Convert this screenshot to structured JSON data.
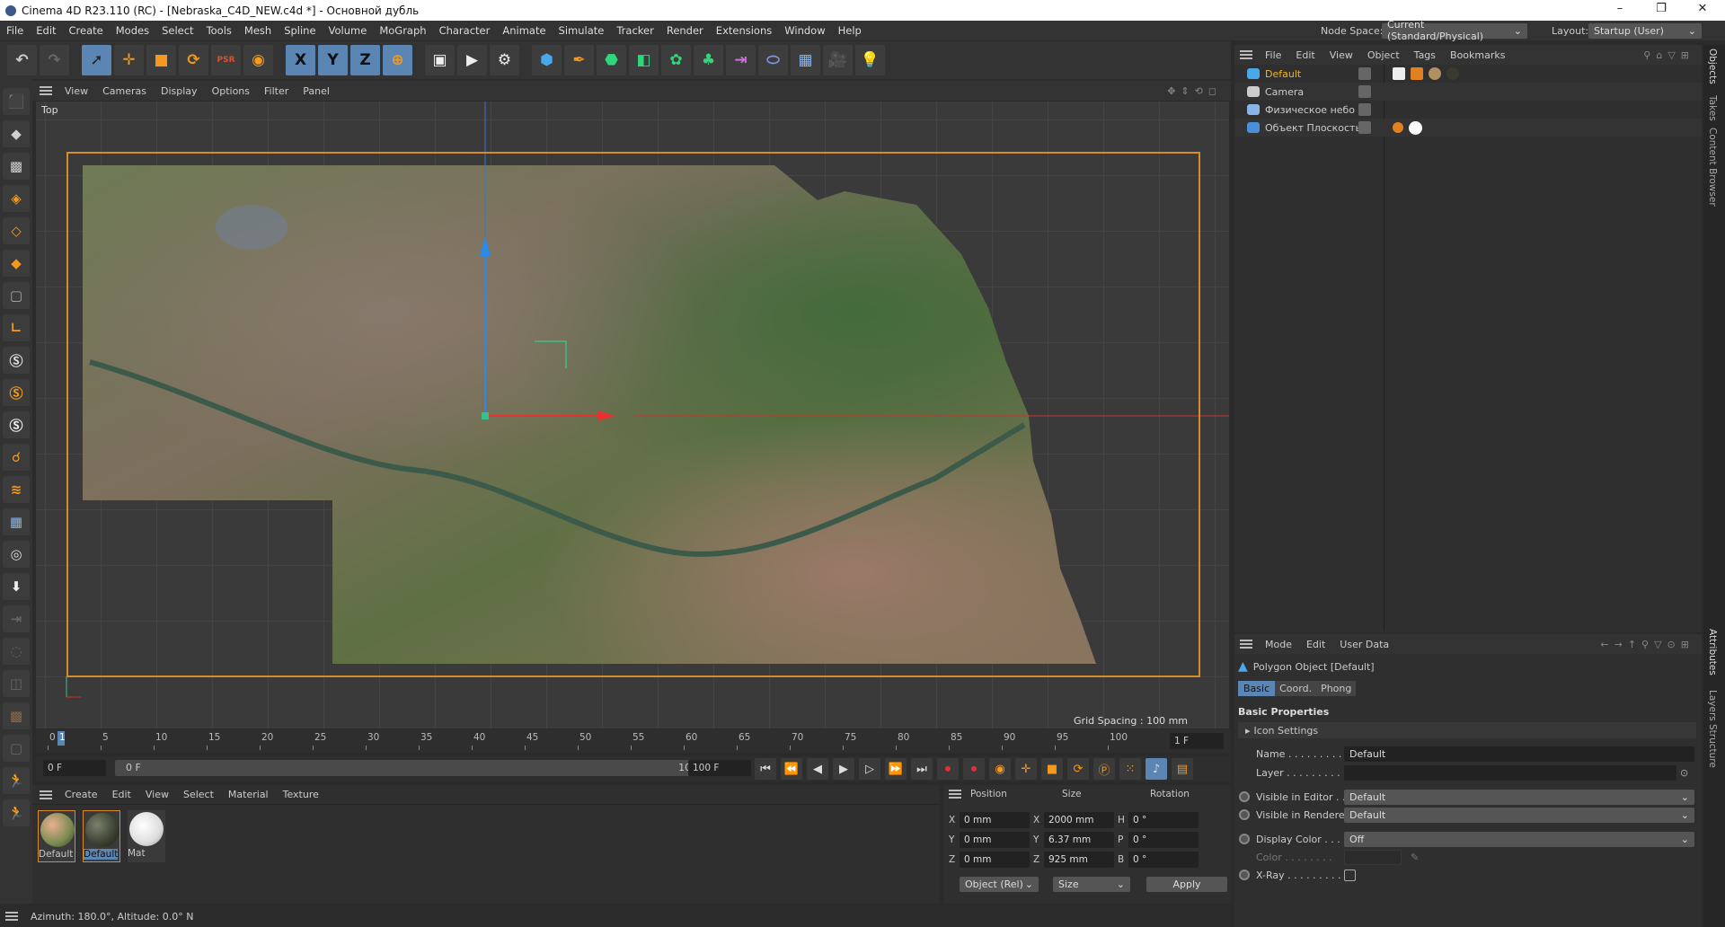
{
  "title": "Cinema 4D R23.110 (RC) - [Nebraska_C4D_NEW.c4d *] - Основной дубль",
  "window_controls": {
    "minimize": "–",
    "restore": "❐",
    "close": "✕"
  },
  "menu": [
    "File",
    "Edit",
    "Create",
    "Modes",
    "Select",
    "Tools",
    "Mesh",
    "Spline",
    "Volume",
    "MoGraph",
    "Character",
    "Animate",
    "Simulate",
    "Tracker",
    "Render",
    "Extensions",
    "Window",
    "Help"
  ],
  "node_space": {
    "label": "Node Space:",
    "value": "Current (Standard/Physical)"
  },
  "layout": {
    "label": "Layout:",
    "value": "Startup (User)"
  },
  "toolbar": {
    "x": "X",
    "y": "Y",
    "z": "Z"
  },
  "viewport": {
    "menu": [
      "View",
      "Cameras",
      "Display",
      "Options",
      "Filter",
      "Panel"
    ],
    "view_name": "Top",
    "grid_spacing": "Grid Spacing : 100 mm"
  },
  "timeline": {
    "ticks": [
      "0",
      "5",
      "10",
      "15",
      "20",
      "25",
      "30",
      "35",
      "40",
      "45",
      "50",
      "55",
      "60",
      "65",
      "70",
      "75",
      "80",
      "85",
      "90",
      "95",
      "100"
    ],
    "current_frame_marker": "1",
    "current_frame": "1 F",
    "start": "0 F",
    "range_start": "0 F",
    "range_end": "100 F",
    "end": "100 F"
  },
  "materials": {
    "menu": [
      "Create",
      "Edit",
      "View",
      "Select",
      "Material",
      "Texture"
    ],
    "items": [
      {
        "name": "Default"
      },
      {
        "name": "Default"
      },
      {
        "name": "Mat"
      }
    ]
  },
  "coords": {
    "headers": [
      "Position",
      "Size",
      "Rotation"
    ],
    "rows": [
      {
        "pl": "X",
        "p": "0 mm",
        "sl": "X",
        "s": "2000 mm",
        "rl": "H",
        "r": "0 °"
      },
      {
        "pl": "Y",
        "p": "0 mm",
        "sl": "Y",
        "s": "6.37 mm",
        "rl": "P",
        "r": "0 °"
      },
      {
        "pl": "Z",
        "p": "0 mm",
        "sl": "Z",
        "s": "925 mm",
        "rl": "B",
        "r": "0 °"
      }
    ],
    "mode": "Object (Rel)",
    "size_mode": "Size",
    "apply": "Apply"
  },
  "status": "Azimuth: 180.0°, Altitude: 0.0°  N",
  "objects": {
    "menu": [
      "File",
      "Edit",
      "View",
      "Object",
      "Tags",
      "Bookmarks"
    ],
    "items": [
      {
        "name": "Default",
        "color": "#f0b428"
      },
      {
        "name": "Camera",
        "color": "#cccccc"
      },
      {
        "name": "Физическое небо",
        "color": "#cccccc"
      },
      {
        "name": "Объект Плоскость",
        "color": "#cccccc"
      }
    ]
  },
  "attributes": {
    "menu": [
      "Mode",
      "Edit",
      "User Data"
    ],
    "object_title": "Polygon Object [Default]",
    "tabs": [
      "Basic",
      "Coord.",
      "Phong"
    ],
    "section": "Basic Properties",
    "icon_settings": "Icon Settings",
    "fields": {
      "name_label": "Name . . . . . . . . .",
      "name": "Default",
      "layer_label": "Layer . . . . . . . . . .",
      "vis_editor_label": "Visible in Editor . .",
      "vis_editor": "Default",
      "vis_render_label": "Visible in Renderer",
      "vis_render": "Default",
      "display_color_label": "Display Color . . . .",
      "display_color": "Off",
      "color_label": "Color . . . . . . . .",
      "xray_label": "X-Ray . . . . . . . . ."
    }
  },
  "side_tabs": [
    "Objects",
    "Takes",
    "Content Browser",
    "Attributes",
    "Layers",
    "Structure"
  ],
  "colors": {
    "accent": "#5b86b4",
    "selection": "#d98a2a"
  }
}
